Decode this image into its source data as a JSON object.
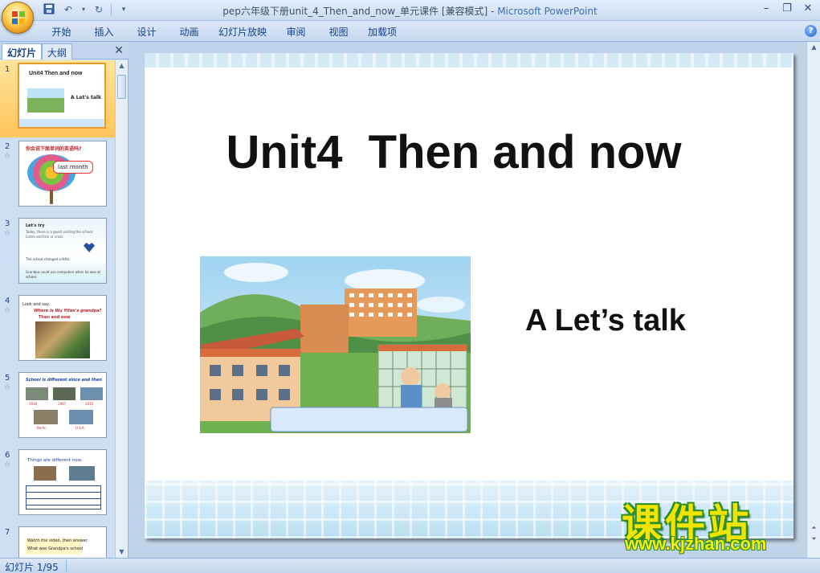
{
  "window": {
    "title": "pep六年级下册unit_4_Then_and_now_单元课件 [兼容模式]",
    "title_sep": " - ",
    "app_name": "Microsoft PowerPoint"
  },
  "ribbon": {
    "tabs": [
      "开始",
      "插入",
      "设计",
      "动画",
      "幻灯片放映",
      "审阅",
      "视图",
      "加载项"
    ]
  },
  "left_pane": {
    "tab_slides": "幻灯片",
    "tab_outline": "大纲",
    "thumbnails": [
      {
        "num": "1",
        "title": "Unit4  Then and now",
        "sub": "A Let's talk"
      },
      {
        "num": "2",
        "title": "你会说下面单词的英语吗?",
        "sub": "last month"
      },
      {
        "num": "3",
        "title": "Let's try",
        "sub": "Today, there is a guest visiting the school. Listen and tick or cross.",
        "line1": "The school changed a little.",
        "line2": "Grandpa could use computers when he was at school."
      },
      {
        "num": "4",
        "title": "Look and say.",
        "sub": "Where is Wu Yifan's grandpa?",
        "line1": "Then and now"
      },
      {
        "num": "5",
        "title": "School is different since and then",
        "labels": [
          "1930",
          "1967",
          "2015",
          "Berlin",
          "U.S.A"
        ]
      },
      {
        "num": "6",
        "title": "Things are different now."
      },
      {
        "num": "7",
        "title": "Watch the video, then answer.",
        "sub": "What was Grandpa's school"
      }
    ]
  },
  "slide": {
    "title": "Unit4  Then and now",
    "subtitle": "A Let’s talk"
  },
  "watermark": {
    "cn": "课件站",
    "url": "www.kjzhan.com"
  },
  "status": {
    "slide_counter": "幻灯片 1/95"
  },
  "colors": {
    "ribbon_text": "#15428b",
    "selection": "#ffc45a",
    "watermark_fill": "#f2e400",
    "watermark_stroke": "#2a8f2a"
  }
}
